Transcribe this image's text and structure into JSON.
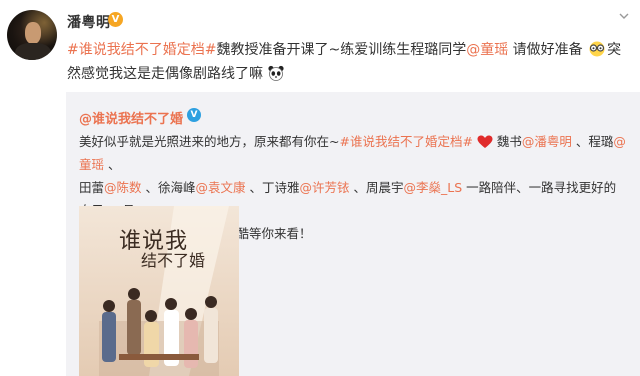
{
  "author": {
    "name": "潘粤明",
    "verified_badge": "V"
  },
  "post": {
    "tag": "#谁说我结不了婚定档#",
    "text1": "魏教授准备开课了~练爱训练生程璐同学",
    "mention": "@童瑶",
    "text2": " 请做好准备",
    "text3": "突然感觉我这是走偶像剧路线了嘛",
    "emoji1": "glasses-emoji",
    "emoji2": "panda-emoji"
  },
  "quoted": {
    "account": "@谁说我结不了婚",
    "verified_badge": "V",
    "text_intro": "美好似乎就是光照进来的地方，原来都有你在~",
    "tag": "#谁说我结不了婚定档#",
    "heart": "heart-emoji",
    "role1": " 魏书",
    "m1": "@潘粤明",
    "role2": " 、程璐",
    "m2": "@童瑶",
    "role3": " 、",
    "role4": "田蕾",
    "m3": "@陈数",
    "role5": " 、徐海峰",
    "m4": "@袁文康",
    "role6": " 、丁诗雅",
    "m5": "@许芳铱",
    "role7": " 、周晨宇",
    "m6": "@李燊_LS",
    "role8": " 一路陪伴、一路寻找更好的自己~5月",
    "line_end": "26日，CCTV8、爱奇艺、优酷等你来看！"
  },
  "poster": {
    "title": "谁说我结不了婚",
    "colors": {
      "bg_top": "#f3e6d8",
      "bg_bottom": "#e8d2bd"
    }
  },
  "colors": {
    "link": "#eb7350",
    "badge_orange": "#f6a623",
    "badge_blue": "#2ea0e0",
    "quote_bg": "#f2f2f5"
  }
}
